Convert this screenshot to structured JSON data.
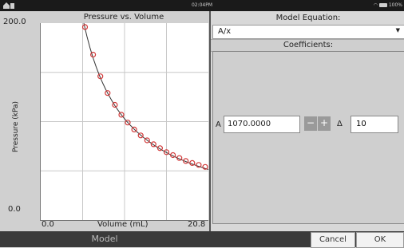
{
  "status_bar": {
    "time": "02:04PM",
    "battery": "100%",
    "wifi_icon": "wifi-icon",
    "home_icon": "home-icon"
  },
  "chart_data": {
    "type": "scatter",
    "title": "Pressure vs. Volume",
    "xlabel": "Volume (mL)",
    "ylabel": "Pressure (kPa)",
    "xlim": [
      0.0,
      20.8
    ],
    "ylim": [
      0.0,
      200.0
    ],
    "x_tick_labels": [
      "0.0",
      "20.8"
    ],
    "y_tick_labels": [
      "200.0",
      "0.0"
    ],
    "grid": true,
    "points": [
      {
        "x": 5.5,
        "y": 196
      },
      {
        "x": 6.5,
        "y": 168
      },
      {
        "x": 7.4,
        "y": 146
      },
      {
        "x": 8.3,
        "y": 129
      },
      {
        "x": 9.2,
        "y": 117
      },
      {
        "x": 10.0,
        "y": 107
      },
      {
        "x": 10.8,
        "y": 99
      },
      {
        "x": 11.6,
        "y": 92
      },
      {
        "x": 12.4,
        "y": 86
      },
      {
        "x": 13.2,
        "y": 81
      },
      {
        "x": 14.0,
        "y": 77
      },
      {
        "x": 14.8,
        "y": 73
      },
      {
        "x": 15.6,
        "y": 69
      },
      {
        "x": 16.4,
        "y": 66
      },
      {
        "x": 17.2,
        "y": 63
      },
      {
        "x": 18.0,
        "y": 60
      },
      {
        "x": 18.8,
        "y": 58
      },
      {
        "x": 19.6,
        "y": 56
      },
      {
        "x": 20.4,
        "y": 54
      }
    ],
    "fit_equation": "A/x",
    "fit_A": 1070.0,
    "colors": {
      "points": "#d23a3a",
      "fit": "#333333"
    }
  },
  "right_panel": {
    "model_equation_label": "Model Equation:",
    "model_equation_value": "A/x",
    "coefficients_label": "Coefficients:",
    "coef_name": "A",
    "coef_value": "1070.0000",
    "minus_label": "−",
    "plus_label": "+",
    "delta_symbol": "Δ",
    "delta_value": "10"
  },
  "bottom_bar": {
    "model_label": "Model",
    "cancel_label": "Cancel",
    "ok_label": "OK"
  }
}
